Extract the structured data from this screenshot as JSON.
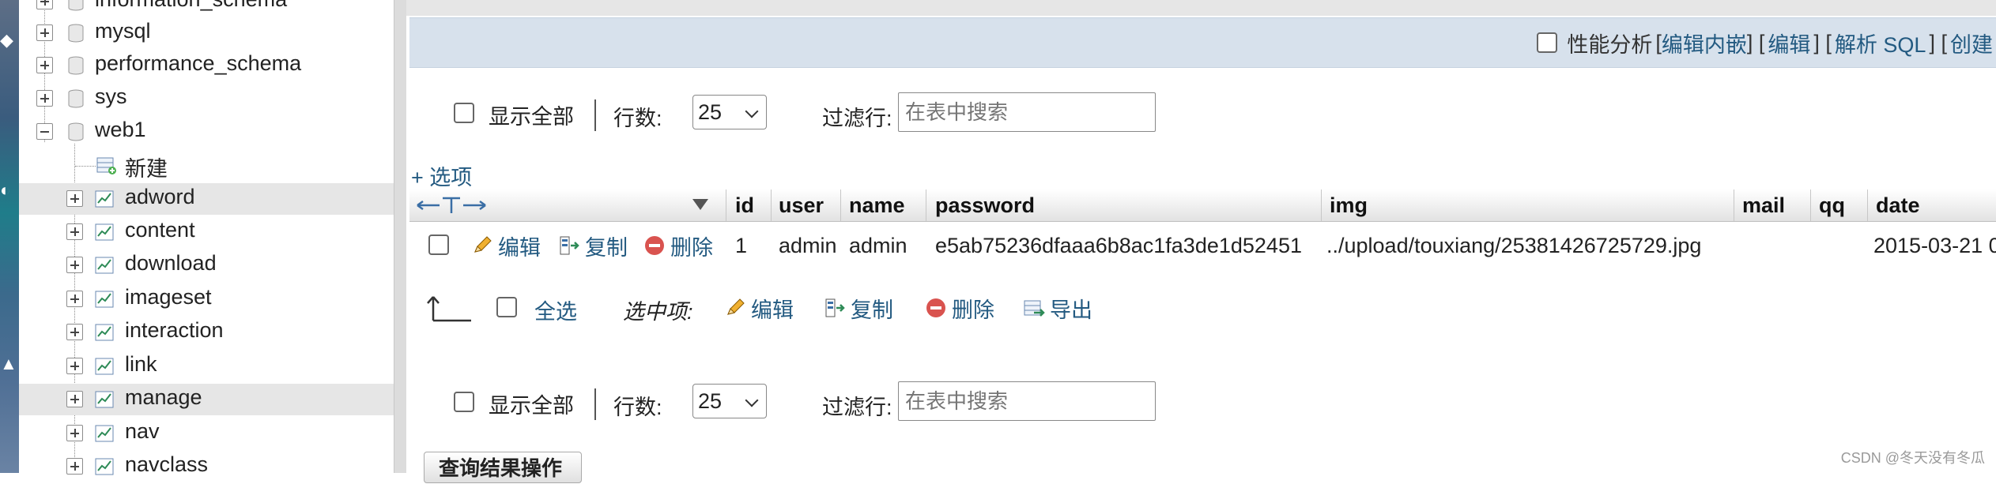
{
  "sidebar": {
    "databases": [
      {
        "label": "information_schema",
        "expanded": false
      },
      {
        "label": "mysql",
        "expanded": false
      },
      {
        "label": "performance_schema",
        "expanded": false
      },
      {
        "label": "sys",
        "expanded": false
      },
      {
        "label": "web1",
        "expanded": true
      }
    ],
    "new_label": "新建",
    "tables": [
      "adword",
      "content",
      "download",
      "imageset",
      "interaction",
      "link",
      "manage",
      "nav",
      "navclass"
    ]
  },
  "topbar": {
    "profiling_label": "性能分析",
    "edit_inline": "编辑内嵌",
    "edit": "编辑",
    "explain_sql": "解析 SQL",
    "create_php": "创建 PHP 代码"
  },
  "nav_controls": {
    "show_all": "显示全部",
    "rows_label": "行数:",
    "rows_value": "25",
    "filter_label": "过滤行:",
    "filter_placeholder": "在表中搜索"
  },
  "options_link": "+ 选项",
  "table": {
    "columns": [
      "id",
      "user",
      "name",
      "password",
      "img",
      "mail",
      "qq",
      "date"
    ],
    "row": {
      "edit": "编辑",
      "copy": "复制",
      "delete": "删除",
      "id": "1",
      "user": "admin",
      "name": "admin",
      "password": "e5ab75236dfaaa6b8ac1fa3de1d52451",
      "img": "../upload/touxiang/25381426725729.jpg",
      "mail": "",
      "qq": "",
      "date": "2015-03-21 0"
    }
  },
  "bulk": {
    "select_all": "全选",
    "with_selected": "选中项:",
    "edit": "编辑",
    "copy": "复制",
    "delete": "删除",
    "export": "导出"
  },
  "query_results_button": "查询结果操作",
  "watermark": "CSDN @冬天没有冬瓜",
  "colors": {
    "link": "#235a81",
    "topbar_bg": "#d7e1ec",
    "highlight_row": "#e6e6e6",
    "delete_icon": "#d9534f"
  }
}
